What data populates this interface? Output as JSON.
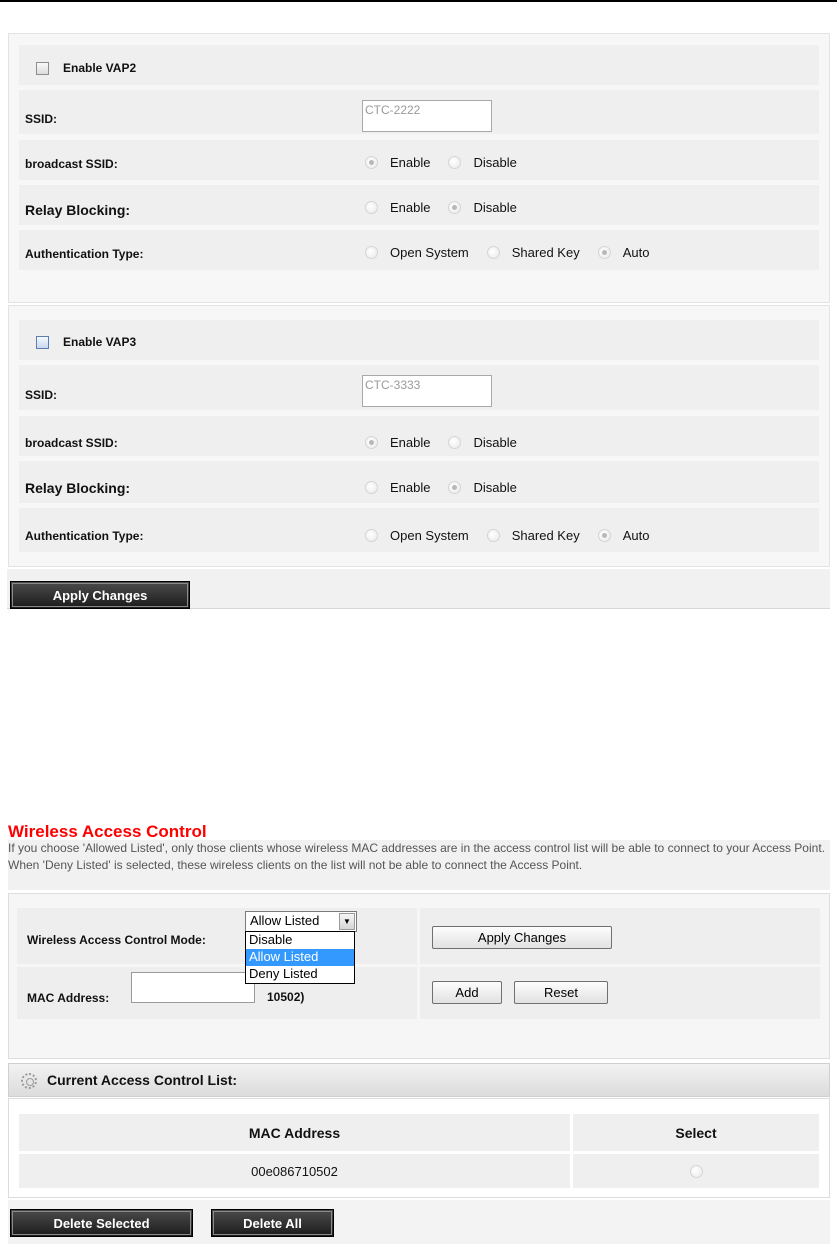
{
  "vap2": {
    "enable_label": "Enable VAP2",
    "ssid_label": "SSID:",
    "ssid_value": "CTC-2222",
    "broadcast_label": "broadcast SSID:",
    "broadcast_enable": "Enable",
    "broadcast_disable": "Disable",
    "relay_label": "Relay Blocking:",
    "relay_enable": "Enable",
    "relay_disable": "Disable",
    "auth_label": "Authentication Type:",
    "auth_open": "Open System",
    "auth_shared": "Shared Key",
    "auth_auto": "Auto"
  },
  "vap3": {
    "enable_label": "Enable VAP3",
    "ssid_label": "SSID:",
    "ssid_value": "CTC-3333",
    "broadcast_label": "broadcast SSID:",
    "broadcast_enable": "Enable",
    "broadcast_disable": "Disable",
    "relay_label": "Relay Blocking:",
    "relay_enable": "Enable",
    "relay_disable": "Disable",
    "auth_label": "Authentication Type:",
    "auth_open": "Open System",
    "auth_shared": "Shared Key",
    "auth_auto": "Auto"
  },
  "vap_apply_label": "Apply Changes",
  "wac": {
    "title": "Wireless Access Control",
    "description": "If you choose 'Allowed Listed', only those clients whose wireless MAC addresses are in the access control list will be able to connect to your Access Point. When 'Deny Listed' is selected, these wireless clients on the list will not be able to connect the Access Point.",
    "mode_label": "Wireless Access Control Mode:",
    "mode_selected": "Allow Listed",
    "mode_options": [
      "Disable",
      "Allow Listed",
      "Deny Listed"
    ],
    "apply_label": "Apply Changes",
    "mac_label": "MAC Address:",
    "mac_hint": "10502)",
    "add_label": "Add",
    "reset_label": "Reset"
  },
  "acl": {
    "title": "Current Access Control List:",
    "col_mac": "MAC Address",
    "col_select": "Select",
    "rows": [
      {
        "mac": "00e086710502"
      }
    ],
    "delete_selected_label": "Delete Selected",
    "delete_all_label": "Delete All"
  },
  "colors": {
    "title_red": "#ff0000",
    "highlight_blue": "#3399ff",
    "dark_button": "#1c1c1c"
  }
}
